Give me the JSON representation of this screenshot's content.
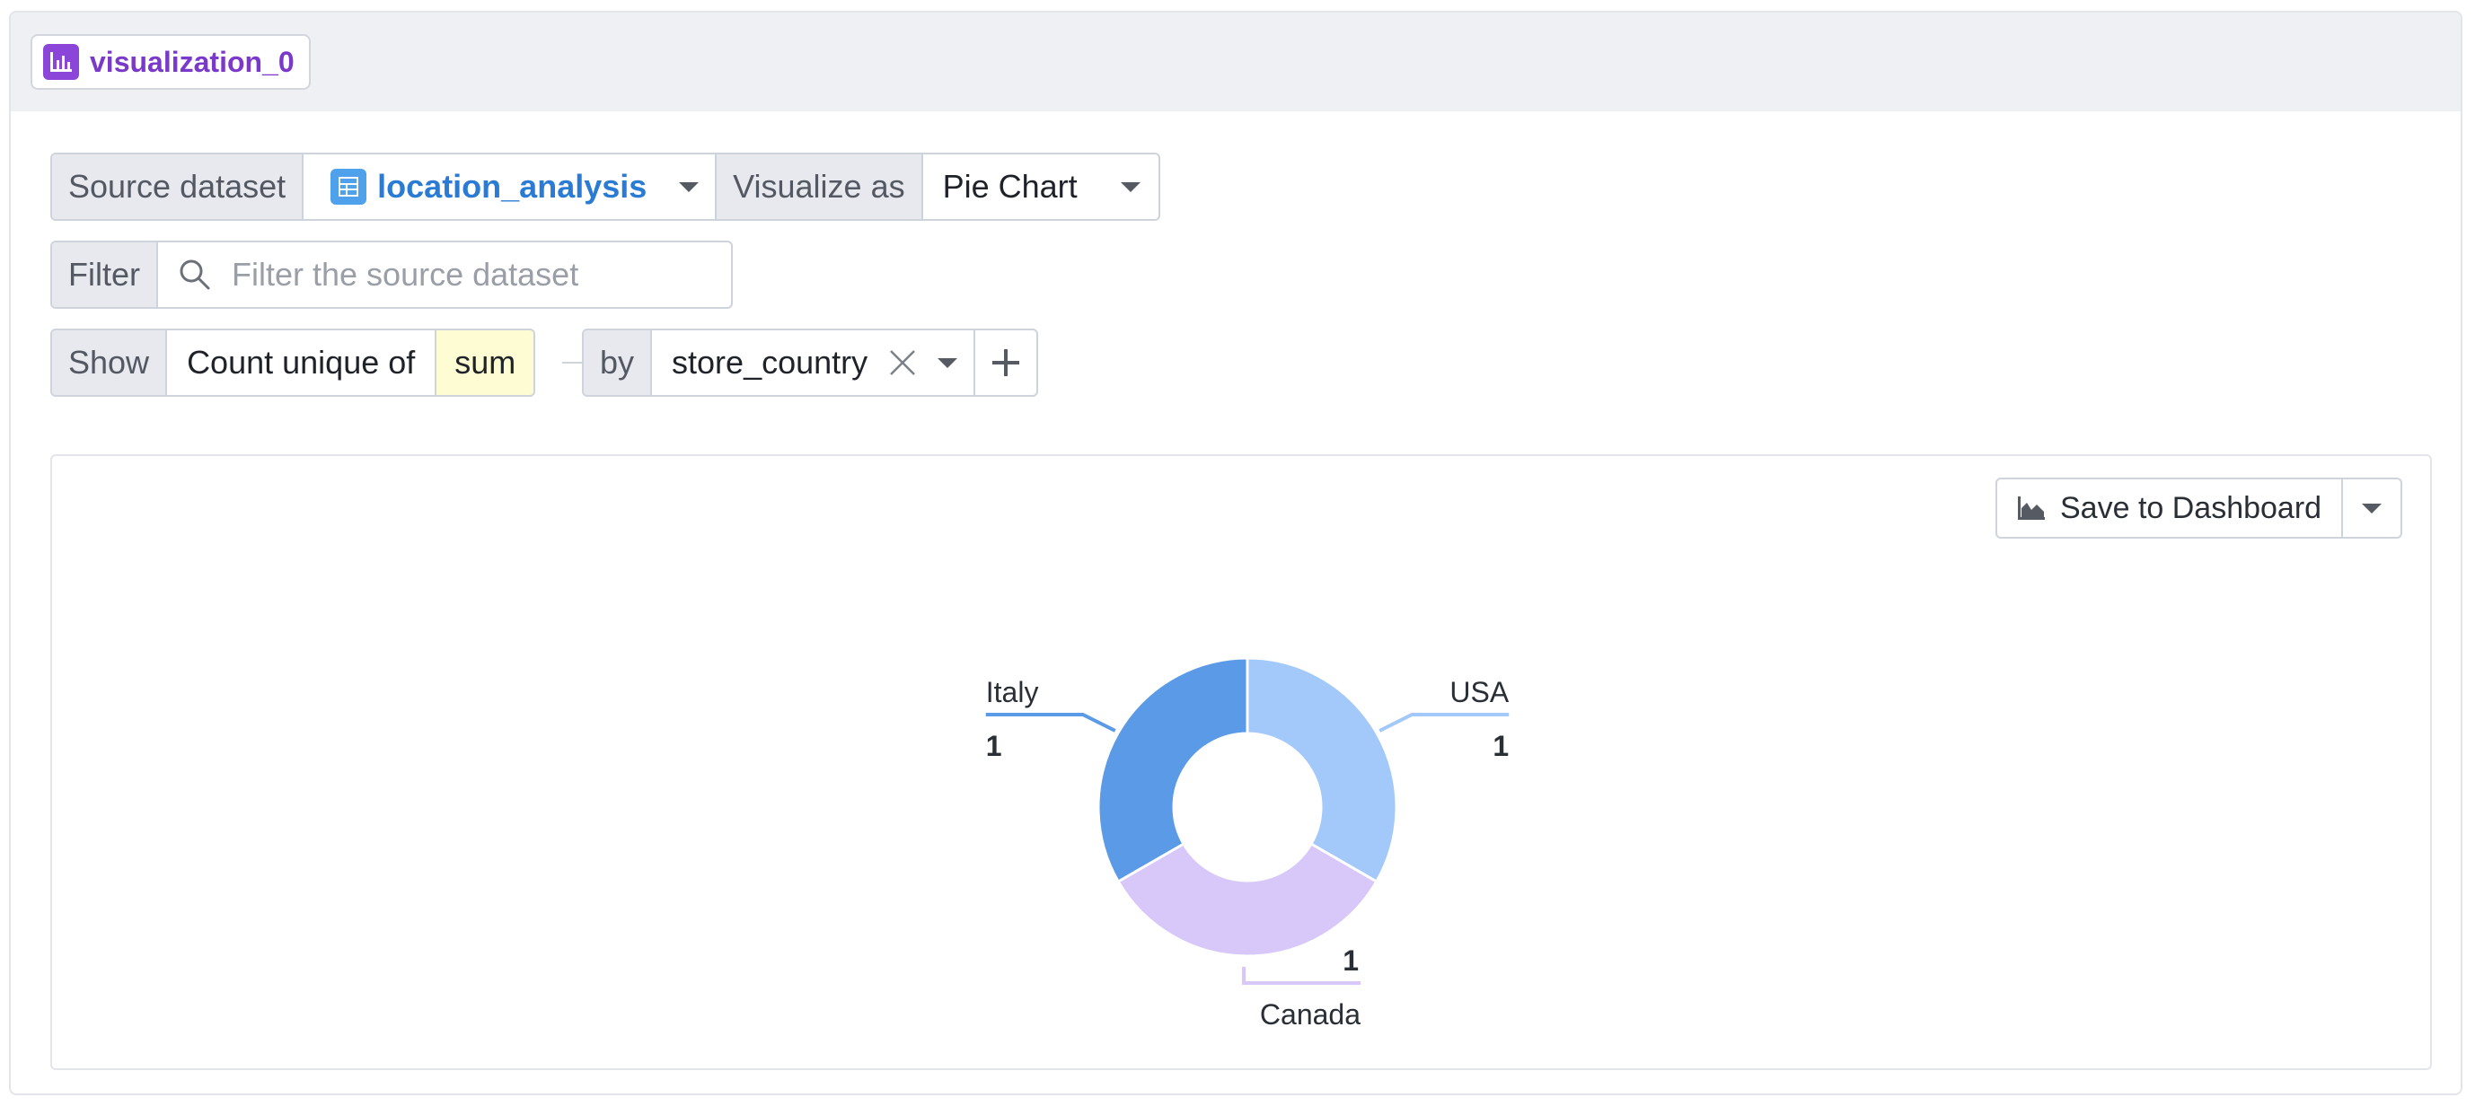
{
  "header": {
    "title": "visualization_0",
    "title_icon": "bar-chart-icon",
    "accent_color": "#7b39cc"
  },
  "source_row": {
    "source_label": "Source dataset",
    "dataset_name": "location_analysis",
    "dataset_icon": "table-icon",
    "visualize_label": "Visualize as",
    "visualize_value": "Pie Chart"
  },
  "filter_row": {
    "label": "Filter",
    "placeholder": "Filter the source dataset"
  },
  "show_row": {
    "label": "Show",
    "aggregate": "Count unique of",
    "field": "sum",
    "by_label": "by",
    "group_by": "store_country"
  },
  "toolbar": {
    "save_label": "Save to Dashboard"
  },
  "chart_data": {
    "type": "pie",
    "donut": true,
    "slices": [
      {
        "label": "USA",
        "value": 1,
        "color": "#a3c8fa"
      },
      {
        "label": "Canada",
        "value": 1,
        "color": "#d8c8fa"
      },
      {
        "label": "Italy",
        "value": 1,
        "color": "#5b9ae6"
      }
    ]
  }
}
